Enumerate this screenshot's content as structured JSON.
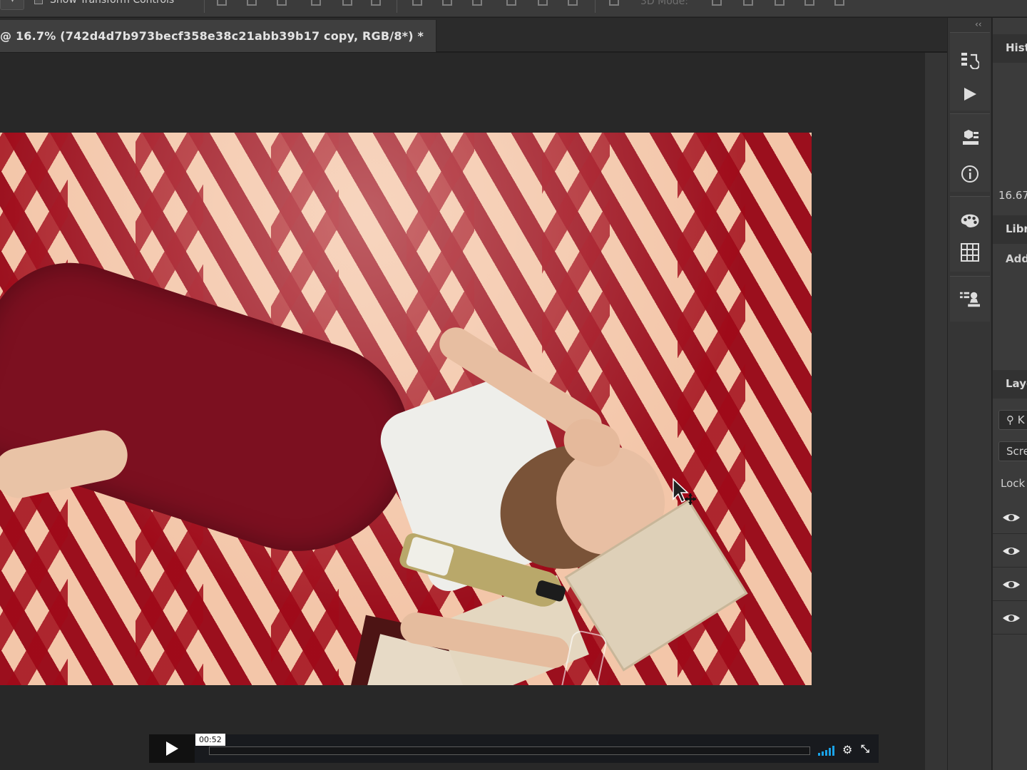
{
  "options_bar": {
    "checkbox_label": "Show Transform Controls",
    "mode_label": "3D Mode:"
  },
  "document": {
    "tab_title": "@ 16.7% (742d4d7b973becf358e38c21abb39b17 copy, RGB/8*) *"
  },
  "video_player": {
    "timecode": "00:52",
    "progress": 0.0
  },
  "dock": {
    "collapse_glyph": "‹‹",
    "icons": [
      "history-icon",
      "actions-play-icon",
      "3d-properties-icon",
      "info-icon",
      "color-palette-icon",
      "swatches-grid-icon",
      "clone-source-icon"
    ]
  },
  "right_panel": {
    "history_tab": "Hist",
    "zoom_value": "16.67",
    "libraries_tab": "Libr",
    "add_label": "Add",
    "layers_tab": "Laye",
    "layer_filter": "K",
    "blend_mode": "Scre",
    "lock_label": "Lock"
  }
}
